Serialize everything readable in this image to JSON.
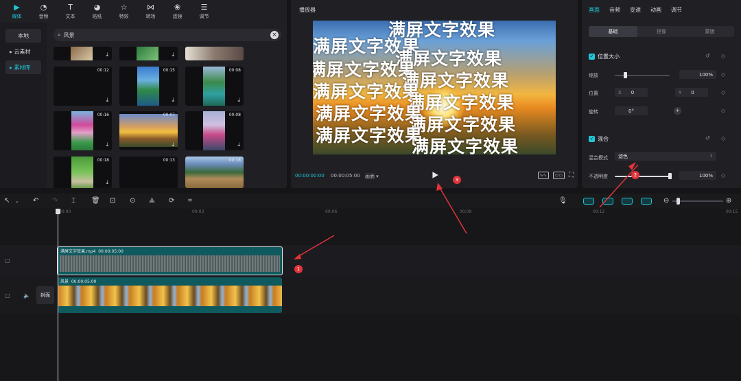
{
  "media": {
    "tabs": [
      {
        "label": "媒体",
        "icon": "media-icon",
        "active": true
      },
      {
        "label": "音频",
        "icon": "audio-icon"
      },
      {
        "label": "文本",
        "icon": "text-icon"
      },
      {
        "label": "贴纸",
        "icon": "sticker-icon"
      },
      {
        "label": "特效",
        "icon": "effects-icon"
      },
      {
        "label": "转场",
        "icon": "transition-icon"
      },
      {
        "label": "滤镜",
        "icon": "filter-icon"
      },
      {
        "label": "调节",
        "icon": "adjust-icon"
      }
    ],
    "side": {
      "local": "本地",
      "cloud": "▸ 云素材",
      "library": "▸ 素材库"
    },
    "search": {
      "value": "风景"
    },
    "durations": [
      "00:12",
      "00:15",
      "00:08",
      "00:16",
      "00:07",
      "00:08",
      "00:18",
      "00:13",
      "00:18"
    ]
  },
  "player": {
    "title": "播放器",
    "current_time": "00:00:00:00",
    "total_time": "00:00:05:00",
    "ratio": "画面 ▾",
    "overlay_text": "满屏文字效果"
  },
  "inspector": {
    "tabs": [
      {
        "label": "画面",
        "active": true
      },
      {
        "label": "音频"
      },
      {
        "label": "变速"
      },
      {
        "label": "动画"
      },
      {
        "label": "调节"
      }
    ],
    "subtabs": [
      "基础",
      "抠像",
      "蒙版"
    ],
    "position_size": {
      "title": "位置大小",
      "scale_label": "缩放",
      "scale_value": "100%",
      "position_label": "位置",
      "x_label": "X",
      "x_value": "0",
      "y_label": "Y",
      "y_value": "0",
      "rotate_label": "旋转",
      "rotate_value": "0°"
    },
    "blend": {
      "title": "混合",
      "mode_label": "混合模式",
      "mode_value": "滤色",
      "opacity_label": "不透明度",
      "opacity_value": "100%"
    },
    "scale_level": 0.1,
    "opacity_level": 1.0
  },
  "timeline": {
    "ruler": [
      "00:00",
      "00:03",
      "00:06",
      "00:09",
      "00:12",
      "00:15"
    ],
    "clip1": {
      "name": "满屏文字效果.mp4",
      "duration": "00:00:05:00"
    },
    "clip2": {
      "name": "风景",
      "duration": "00:00:05:00"
    },
    "cover": "封面"
  },
  "annotations": [
    "1",
    "2",
    "3"
  ],
  "colors": {
    "accent": "#1fc6d8",
    "marker": "#e0343b"
  }
}
